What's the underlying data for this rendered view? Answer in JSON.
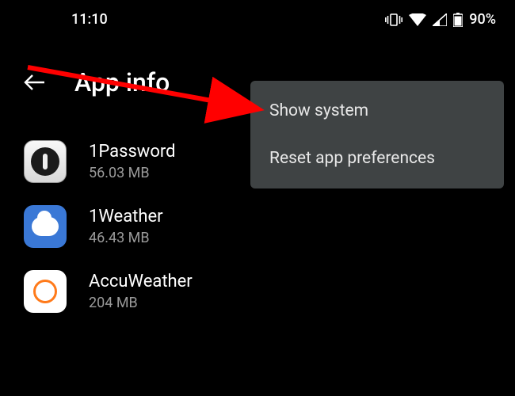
{
  "status": {
    "time": "11:10",
    "battery_label": "90%"
  },
  "header": {
    "title": "App info"
  },
  "apps": [
    {
      "name": "1Password",
      "size": "56.03 MB"
    },
    {
      "name": "1Weather",
      "size": "46.43 MB"
    },
    {
      "name": "AccuWeather",
      "size": "204 MB"
    }
  ],
  "menu": {
    "items": [
      "Show system",
      "Reset app preferences"
    ]
  }
}
